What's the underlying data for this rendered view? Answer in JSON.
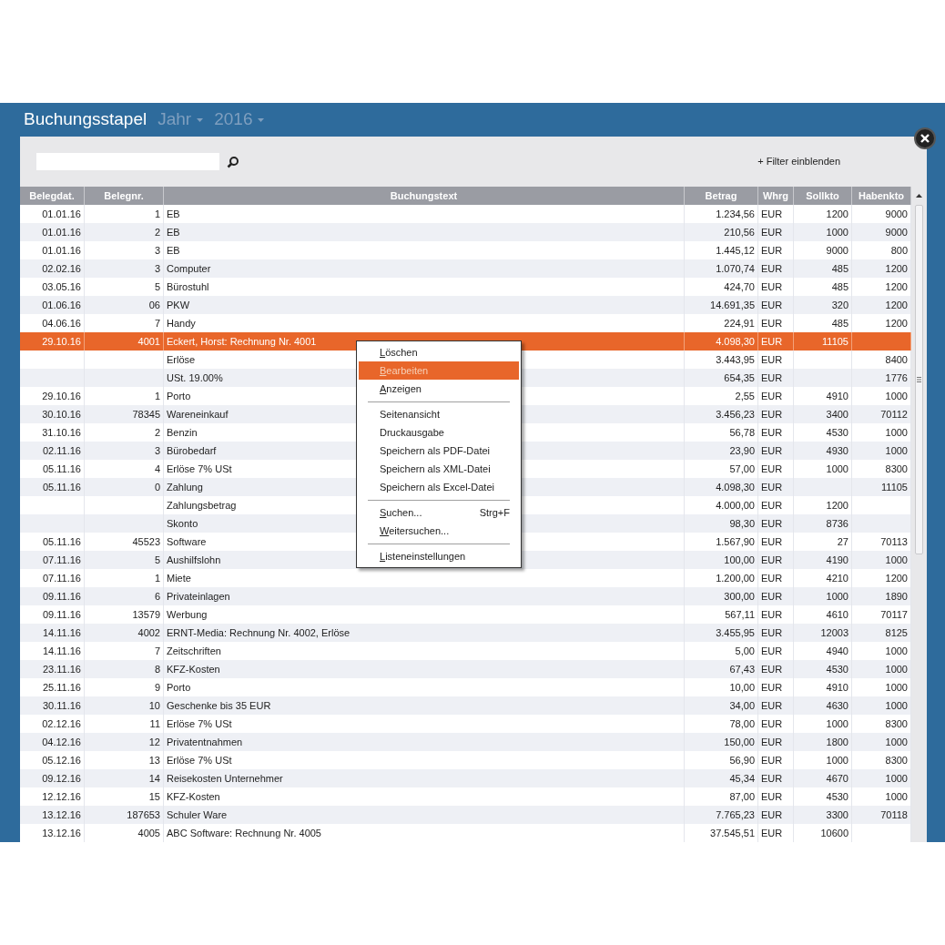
{
  "window": {
    "title": "Buchungsstapel",
    "year_label": "Jahr",
    "year": "2016"
  },
  "toolbar": {
    "filter_link": "+ Filter einblenden"
  },
  "table": {
    "columns": [
      "Belegdat.",
      "Belegnr.",
      "Buchungstext",
      "Betrag",
      "Whrg",
      "Sollkto",
      "Habenkto"
    ],
    "rows": [
      {
        "date": "01.01.16",
        "number": "1",
        "text": "EB",
        "amount": "1.234,56",
        "currency": "EUR",
        "debit": "1200",
        "credit": "9000",
        "selected": false
      },
      {
        "date": "01.01.16",
        "number": "2",
        "text": "EB",
        "amount": "210,56",
        "currency": "EUR",
        "debit": "1000",
        "credit": "9000",
        "selected": false
      },
      {
        "date": "01.01.16",
        "number": "3",
        "text": "EB",
        "amount": "1.445,12",
        "currency": "EUR",
        "debit": "9000",
        "credit": "800",
        "selected": false
      },
      {
        "date": "02.02.16",
        "number": "3",
        "text": "Computer",
        "amount": "1.070,74",
        "currency": "EUR",
        "debit": "485",
        "credit": "1200",
        "selected": false
      },
      {
        "date": "03.05.16",
        "number": "5",
        "text": "Bürostuhl",
        "amount": "424,70",
        "currency": "EUR",
        "debit": "485",
        "credit": "1200",
        "selected": false
      },
      {
        "date": "01.06.16",
        "number": "06",
        "text": "PKW",
        "amount": "14.691,35",
        "currency": "EUR",
        "debit": "320",
        "credit": "1200",
        "selected": false
      },
      {
        "date": "04.06.16",
        "number": "7",
        "text": "Handy",
        "amount": "224,91",
        "currency": "EUR",
        "debit": "485",
        "credit": "1200",
        "selected": false
      },
      {
        "date": "29.10.16",
        "number": "4001",
        "text": "Eckert, Horst: Rechnung Nr. 4001",
        "amount": "4.098,30",
        "currency": "EUR",
        "debit": "11105",
        "selected": true
      },
      {
        "text": "Erlöse",
        "amount": "3.443,95",
        "currency": "EUR",
        "credit": "8400",
        "selected": false
      },
      {
        "text": "USt. 19.00%",
        "amount": "654,35",
        "currency": "EUR",
        "credit": "1776",
        "selected": false
      },
      {
        "date": "29.10.16",
        "number": "1",
        "text": "Porto",
        "amount": "2,55",
        "currency": "EUR",
        "debit": "4910",
        "credit": "1000",
        "selected": false
      },
      {
        "date": "30.10.16",
        "number": "78345",
        "text": "Wareneinkauf",
        "amount": "3.456,23",
        "currency": "EUR",
        "debit": "3400",
        "credit": "70112",
        "selected": false
      },
      {
        "date": "31.10.16",
        "number": "2",
        "text": "Benzin",
        "amount": "56,78",
        "currency": "EUR",
        "debit": "4530",
        "credit": "1000",
        "selected": false
      },
      {
        "date": "02.11.16",
        "number": "3",
        "text": "Bürobedarf",
        "amount": "23,90",
        "currency": "EUR",
        "debit": "4930",
        "credit": "1000",
        "selected": false
      },
      {
        "date": "05.11.16",
        "number": "4",
        "text": "Erlöse 7% USt",
        "amount": "57,00",
        "currency": "EUR",
        "debit": "1000",
        "credit": "8300",
        "selected": false
      },
      {
        "date": "05.11.16",
        "number": "0",
        "text": "Zahlung",
        "amount": "4.098,30",
        "currency": "EUR",
        "credit": "11105",
        "selected": false
      },
      {
        "text": "Zahlungsbetrag",
        "amount": "4.000,00",
        "currency": "EUR",
        "debit": "1200",
        "selected": false
      },
      {
        "text": "Skonto",
        "amount": "98,30",
        "currency": "EUR",
        "debit": "8736",
        "selected": false
      },
      {
        "date": "05.11.16",
        "number": "45523",
        "text": "Software",
        "amount": "1.567,90",
        "currency": "EUR",
        "debit": "27",
        "credit": "70113",
        "selected": false
      },
      {
        "date": "07.11.16",
        "number": "5",
        "text": "Aushilfslohn",
        "amount": "100,00",
        "currency": "EUR",
        "debit": "4190",
        "credit": "1000",
        "selected": false
      },
      {
        "date": "07.11.16",
        "number": "1",
        "text": "Miete",
        "amount": "1.200,00",
        "currency": "EUR",
        "debit": "4210",
        "credit": "1200",
        "selected": false
      },
      {
        "date": "09.11.16",
        "number": "6",
        "text": "Privateinlagen",
        "amount": "300,00",
        "currency": "EUR",
        "debit": "1000",
        "credit": "1890",
        "selected": false
      },
      {
        "date": "09.11.16",
        "number": "13579",
        "text": "Werbung",
        "amount": "567,11",
        "currency": "EUR",
        "debit": "4610",
        "credit": "70117",
        "selected": false
      },
      {
        "date": "14.11.16",
        "number": "4002",
        "text": "ERNT-Media: Rechnung Nr. 4002, Erlöse",
        "amount": "3.455,95",
        "currency": "EUR",
        "debit": "12003",
        "credit": "8125",
        "selected": false
      },
      {
        "date": "14.11.16",
        "number": "7",
        "text": "Zeitschriften",
        "amount": "5,00",
        "currency": "EUR",
        "debit": "4940",
        "credit": "1000",
        "selected": false
      },
      {
        "date": "23.11.16",
        "number": "8",
        "text": "KFZ-Kosten",
        "amount": "67,43",
        "currency": "EUR",
        "debit": "4530",
        "credit": "1000",
        "selected": false
      },
      {
        "date": "25.11.16",
        "number": "9",
        "text": "Porto",
        "amount": "10,00",
        "currency": "EUR",
        "debit": "4910",
        "credit": "1000",
        "selected": false
      },
      {
        "date": "30.11.16",
        "number": "10",
        "text": "Geschenke bis 35 EUR",
        "amount": "34,00",
        "currency": "EUR",
        "debit": "4630",
        "credit": "1000",
        "selected": false
      },
      {
        "date": "02.12.16",
        "number": "11",
        "text": "Erlöse 7% USt",
        "amount": "78,00",
        "currency": "EUR",
        "debit": "1000",
        "credit": "8300",
        "selected": false
      },
      {
        "date": "04.12.16",
        "number": "12",
        "text": "Privatentnahmen",
        "amount": "150,00",
        "currency": "EUR",
        "debit": "1800",
        "credit": "1000",
        "selected": false
      },
      {
        "date": "05.12.16",
        "number": "13",
        "text": "Erlöse 7% USt",
        "amount": "56,90",
        "currency": "EUR",
        "debit": "1000",
        "credit": "8300",
        "selected": false
      },
      {
        "date": "09.12.16",
        "number": "14",
        "text": "Reisekosten Unternehmer",
        "amount": "45,34",
        "currency": "EUR",
        "debit": "4670",
        "credit": "1000",
        "selected": false
      },
      {
        "date": "12.12.16",
        "number": "15",
        "text": "KFZ-Kosten",
        "amount": "87,00",
        "currency": "EUR",
        "debit": "4530",
        "credit": "1000",
        "selected": false
      },
      {
        "date": "13.12.16",
        "number": "187653",
        "text": "Schuler Ware",
        "amount": "7.765,23",
        "currency": "EUR",
        "debit": "3300",
        "credit": "70118",
        "selected": false
      },
      {
        "date": "13.12.16",
        "number": "4005",
        "text": "ABC Software: Rechnung Nr. 4005",
        "amount": "37.545,51",
        "currency": "EUR",
        "debit": "10600",
        "selected": false
      }
    ]
  },
  "context_menu": {
    "items": [
      {
        "kind": "item",
        "label": "Löschen",
        "mnemonic": true,
        "selected": false
      },
      {
        "kind": "item",
        "label": "Bearbeiten",
        "mnemonic": true,
        "selected": true
      },
      {
        "kind": "item",
        "label": "Anzeigen",
        "mnemonic": true,
        "selected": false
      },
      {
        "kind": "separator"
      },
      {
        "kind": "item",
        "label": "Seitenansicht",
        "mnemonic": false,
        "selected": false
      },
      {
        "kind": "item",
        "label": "Druckausgabe",
        "mnemonic": false,
        "selected": false
      },
      {
        "kind": "item",
        "label": "Speichern als PDF-Datei",
        "mnemonic": false,
        "selected": false
      },
      {
        "kind": "item",
        "label": "Speichern als XML-Datei",
        "mnemonic": false,
        "selected": false
      },
      {
        "kind": "item",
        "label": "Speichern als Excel-Datei",
        "mnemonic": false,
        "selected": false
      },
      {
        "kind": "separator"
      },
      {
        "kind": "item",
        "label": "Suchen...",
        "shortcut": "Strg+F",
        "mnemonic": true,
        "selected": false
      },
      {
        "kind": "item",
        "label": "Weitersuchen...",
        "mnemonic": true,
        "selected": false
      },
      {
        "kind": "separator"
      },
      {
        "kind": "item",
        "label": "Listeneinstellungen",
        "mnemonic": true,
        "selected": false
      }
    ]
  }
}
